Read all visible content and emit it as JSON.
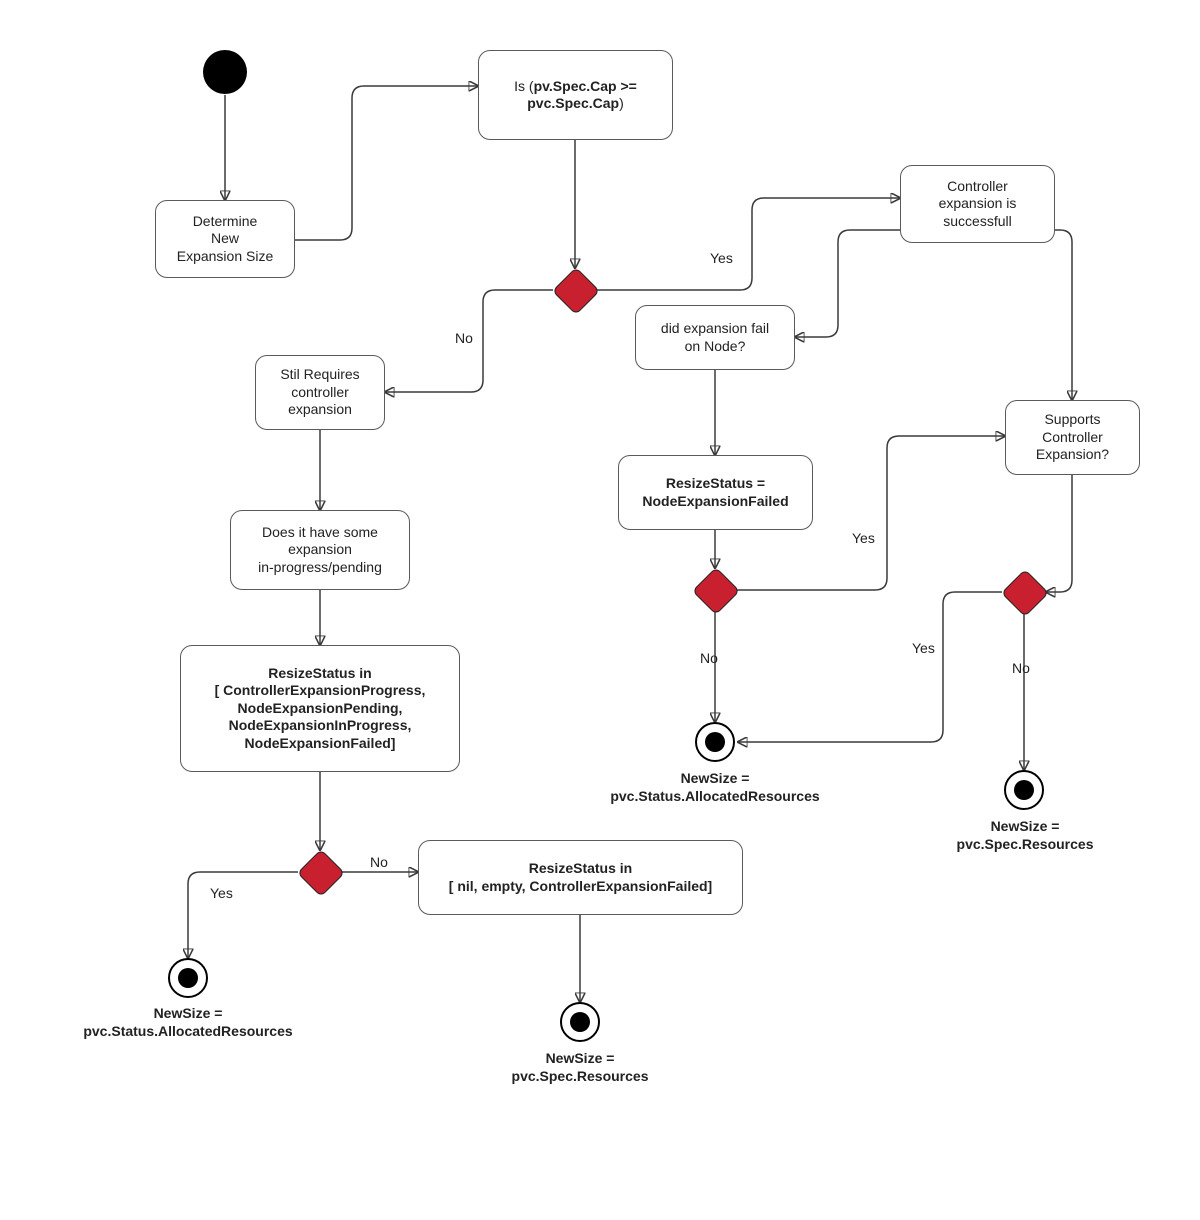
{
  "chart_data": {
    "type": "flowchart",
    "nodes": [
      {
        "id": "start",
        "kind": "initial"
      },
      {
        "id": "determine",
        "kind": "activity",
        "text": "Determine\nNew\nExpansion Size"
      },
      {
        "id": "isCap",
        "kind": "activity",
        "text_prefix": "Is (",
        "text_bold": "pv.Spec.Cap >=\npvc.Spec.Cap",
        "text_suffix": ")"
      },
      {
        "id": "d1",
        "kind": "decision"
      },
      {
        "id": "ctrlSuccess",
        "kind": "activity",
        "text": "Controller\nexpansion is\nsuccessfull"
      },
      {
        "id": "didFail",
        "kind": "activity",
        "text": "did expansion fail\non Node?"
      },
      {
        "id": "resizeNodeFail",
        "kind": "activity",
        "bold": true,
        "text": "ResizeStatus =\nNodeExpansionFailed"
      },
      {
        "id": "d2",
        "kind": "decision"
      },
      {
        "id": "supports",
        "kind": "activity",
        "text": "Supports\nController\nExpansion?"
      },
      {
        "id": "d3",
        "kind": "decision"
      },
      {
        "id": "stillReq",
        "kind": "activity",
        "text": "Stil Requires\ncontroller\nexpansion"
      },
      {
        "id": "doesHave",
        "kind": "activity",
        "text": "Does it have some\nexpansion\nin-progress/pending"
      },
      {
        "id": "resizeSet",
        "kind": "activity",
        "bold": true,
        "text": "ResizeStatus in\n[ ControllerExpansionProgress,\nNodeExpansionPending,\nNodeExpansionInProgress,\nNodeExpansionFailed]"
      },
      {
        "id": "d4",
        "kind": "decision"
      },
      {
        "id": "resizeNil",
        "kind": "activity",
        "bold": true,
        "text": "ResizeStatus in\n[ nil, empty, ControllerExpansionFailed]"
      },
      {
        "id": "endA",
        "kind": "final",
        "label": "NewSize =\npvc.Status.AllocatedResources"
      },
      {
        "id": "endB",
        "kind": "final",
        "label": "NewSize =\npvc.Spec.Resources"
      },
      {
        "id": "endC",
        "kind": "final",
        "label": "NewSize =\npvc.Status.AllocatedResources"
      },
      {
        "id": "endD",
        "kind": "final",
        "label": "NewSize =\npvc.Spec.Resources"
      }
    ],
    "edges": [
      {
        "from": "start",
        "to": "determine"
      },
      {
        "from": "determine",
        "to": "isCap"
      },
      {
        "from": "isCap",
        "to": "d1"
      },
      {
        "from": "d1",
        "to": "ctrlSuccess",
        "label": "Yes"
      },
      {
        "from": "d1",
        "to": "stillReq",
        "label": "No"
      },
      {
        "from": "ctrlSuccess",
        "to": "didFail"
      },
      {
        "from": "ctrlSuccess",
        "to": "supports"
      },
      {
        "from": "didFail",
        "to": "resizeNodeFail"
      },
      {
        "from": "resizeNodeFail",
        "to": "d2"
      },
      {
        "from": "supports",
        "to": "d3"
      },
      {
        "from": "d2",
        "to": "endC",
        "label": "No"
      },
      {
        "from": "d2",
        "to": "supports",
        "label": "Yes"
      },
      {
        "from": "d3",
        "to": "endC",
        "label": "Yes"
      },
      {
        "from": "d3",
        "to": "endD",
        "label": "No"
      },
      {
        "from": "stillReq",
        "to": "doesHave"
      },
      {
        "from": "doesHave",
        "to": "resizeSet"
      },
      {
        "from": "resizeSet",
        "to": "d4"
      },
      {
        "from": "d4",
        "to": "endA",
        "label": "Yes"
      },
      {
        "from": "d4",
        "to": "resizeNil",
        "label": "No"
      },
      {
        "from": "resizeNil",
        "to": "endB"
      }
    ]
  },
  "nodes": {
    "determine": "Determine<br>New<br>Expansion Size",
    "isCap_prefix": "Is (",
    "isCap_bold": "pv.Spec.Cap >=<br>pvc.Spec.Cap",
    "isCap_suffix": ")",
    "ctrlSuccess": "Controller<br>expansion is<br>successfull",
    "didFail": "did expansion fail<br>on Node?",
    "resizeNodeFail": "ResizeStatus =<br>NodeExpansionFailed",
    "supports": "Supports<br>Controller<br>Expansion?",
    "stillReq": "Stil Requires<br>controller<br>expansion",
    "doesHave": "Does it have some<br>expansion<br>in-progress/pending",
    "resizeSet": "ResizeStatus in<br>[ ControllerExpansionProgress,<br>NodeExpansionPending,<br>NodeExpansionInProgress,<br>NodeExpansionFailed]",
    "resizeNil": "ResizeStatus in<br>[ nil, empty, ControllerExpansionFailed]"
  },
  "edgeLabels": {
    "yes": "Yes",
    "no": "No"
  },
  "endLabels": {
    "endA": "NewSize =<br>pvc.Status.AllocatedResources",
    "endB": "NewSize =<br>pvc.Spec.Resources",
    "endC": "NewSize =<br>pvc.Status.AllocatedResources",
    "endD": "NewSize =<br>pvc.Spec.Resources"
  }
}
